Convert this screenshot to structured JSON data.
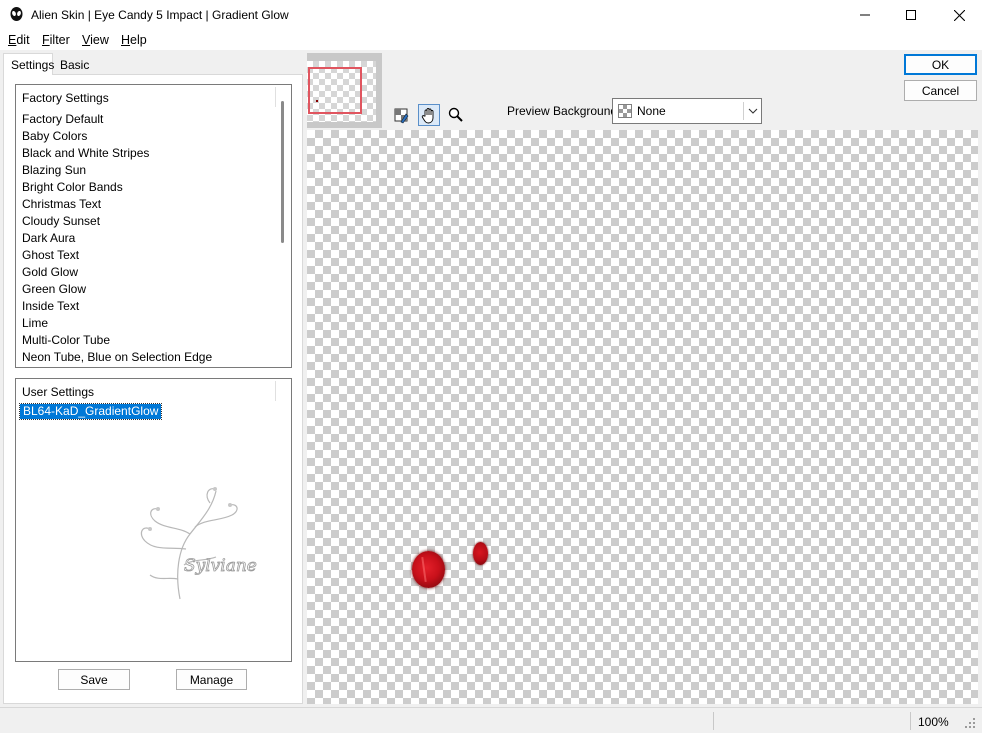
{
  "window": {
    "title": "Alien Skin | Eye Candy 5 Impact | Gradient Glow"
  },
  "menu": [
    {
      "label": "Edit",
      "key": "E",
      "rest": "dit"
    },
    {
      "label": "Filter",
      "key": "F",
      "rest": "ilter"
    },
    {
      "label": "View",
      "key": "V",
      "rest": "iew"
    },
    {
      "label": "Help",
      "key": "H",
      "rest": "elp"
    }
  ],
  "tabs": {
    "settings": "Settings",
    "basic": "Basic"
  },
  "factory_settings": {
    "header": "Factory Settings",
    "items": [
      "Factory Default",
      "Baby Colors",
      "Black and White Stripes",
      "Blazing Sun",
      "Bright Color Bands",
      "Christmas Text",
      "Cloudy Sunset",
      "Dark Aura",
      "Ghost Text",
      "Gold Glow",
      "Green Glow",
      "Inside Text",
      "Lime",
      "Multi-Color Tube",
      "Neon Tube, Blue on Selection Edge"
    ]
  },
  "user_settings": {
    "header": "User Settings",
    "selected": "BL64-KaD_GradientGlow"
  },
  "buttons": {
    "save": "Save",
    "manage": "Manage",
    "ok": "OK",
    "cancel": "Cancel"
  },
  "preview": {
    "label": "Preview Background:",
    "value": "None"
  },
  "status": {
    "zoom": "100%"
  },
  "icons": {
    "app": "alien-skin-icon",
    "tools": [
      "color-picker-icon",
      "hand-pan-icon",
      "zoom-icon"
    ]
  },
  "colors": {
    "selection": "#0078d7",
    "glow_red": "#c8101a"
  }
}
